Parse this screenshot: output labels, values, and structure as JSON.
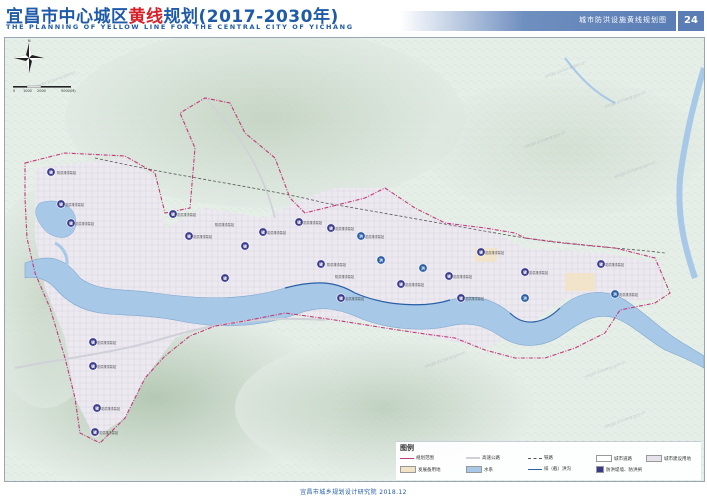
{
  "header": {
    "title_pre": "宜昌市中心城区",
    "title_highlight": "黄线",
    "title_post": "规划(2017-2030年)",
    "subtitle": "THE PLANNING OF YELLOW LINE FOR THE CENTRAL CITY OF YICHANG",
    "sheet_name": "城市防洪设施黄线规划图",
    "page_number": "24"
  },
  "scale_bar": {
    "labels": [
      "0",
      "1000",
      "2000",
      "5000(M)"
    ]
  },
  "compass": {
    "north_label": "N"
  },
  "map_labels": [
    "防洪排涝泵站",
    "防洪排涝泵站",
    "防洪排涝泵站",
    "防洪排涝泵站",
    "防洪排涝泵站",
    "防洪排涝泵站",
    "防洪排涝泵站",
    "防洪排涝泵站",
    "防洪排涝泵站",
    "防洪排涝泵站",
    "防洪排涝泵站",
    "防洪排涝泵站",
    "防洪排涝泵站",
    "防洪排涝泵站",
    "防洪排涝泵站",
    "防洪排涝泵站",
    "防洪排涝泵站",
    "防洪排涝泵站",
    "防洪排涝泵站",
    "防洪排涝泵站",
    "防洪排涝泵站",
    "防洪排涝泵站",
    "防洪排涝泵站",
    "防洪排涝泵站"
  ],
  "symbols": {
    "pump": "键",
    "flood": "洪"
  },
  "watermark": "yingbi.yichang.gov.cn",
  "legend": {
    "title": "图例",
    "items": [
      {
        "label": "规划范围",
        "kind": "boundary"
      },
      {
        "label": "发展备用地",
        "kind": "reserve"
      },
      {
        "label": "高速公路",
        "kind": "road"
      },
      {
        "label": "水系",
        "kind": "water"
      },
      {
        "label": "铁路",
        "kind": "rail"
      },
      {
        "label": "排（截）洪沟",
        "kind": "ditch"
      },
      {
        "label": "城市道路",
        "kind": "street"
      },
      {
        "label": "防洪堤墙、防洪闸",
        "kind": "levee"
      },
      {
        "label": "城市建设用地",
        "kind": "urban"
      }
    ],
    "colors": {
      "boundary": "#c23a7a",
      "reserve": "#f3e3c6",
      "water": "#a7c8e6",
      "urban": "#e6e3ec",
      "pump": "#3a3a8c"
    }
  },
  "footer": {
    "text": "宜昌市城乡规划设计研究院 2018.12"
  }
}
